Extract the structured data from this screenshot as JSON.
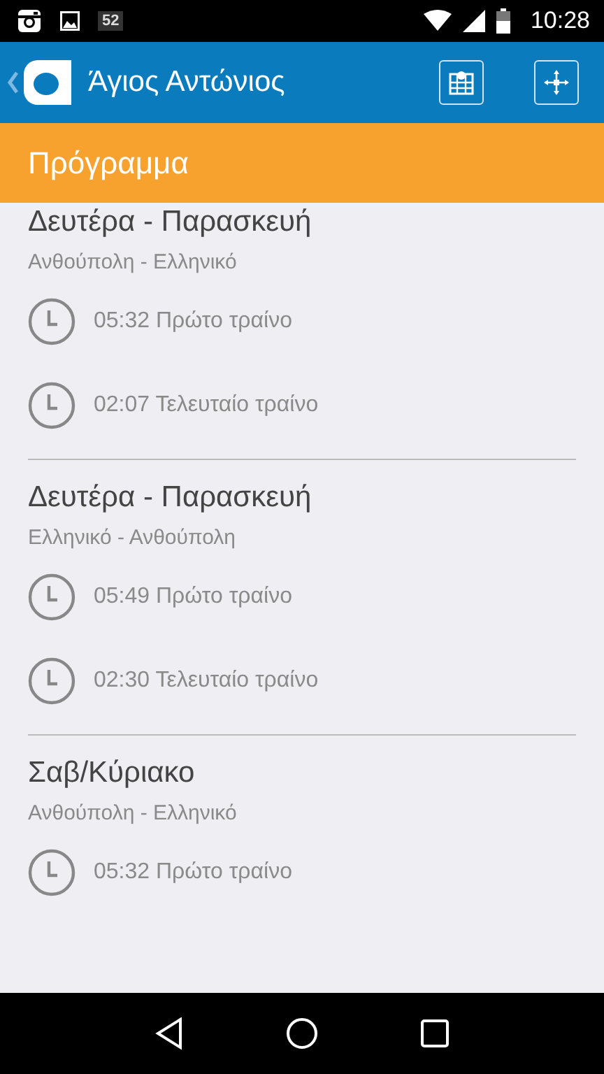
{
  "status_bar": {
    "notification_count": "52",
    "time": "10:28"
  },
  "app_bar": {
    "title": "Άγιος Αντώνιος"
  },
  "section_header": "Πρόγραμμα",
  "schedules": [
    {
      "days": "Δευτέρα - Παρασκευή",
      "route": "Ανθούπολη - Ελληνικό",
      "trains": [
        "05:32 Πρώτο τραίνο",
        "02:07 Τελευταίο τραίνο"
      ]
    },
    {
      "days": "Δευτέρα - Παρασκευή",
      "route": "Ελληνικό - Ανθούπολη",
      "trains": [
        "05:49 Πρώτο τραίνο",
        "02:30 Τελευταίο τραίνο"
      ]
    },
    {
      "days": "Σαβ/Κύριακο",
      "route": "Ανθούπολη - Ελληνικό",
      "trains": [
        "05:32 Πρώτο τραίνο"
      ]
    }
  ]
}
